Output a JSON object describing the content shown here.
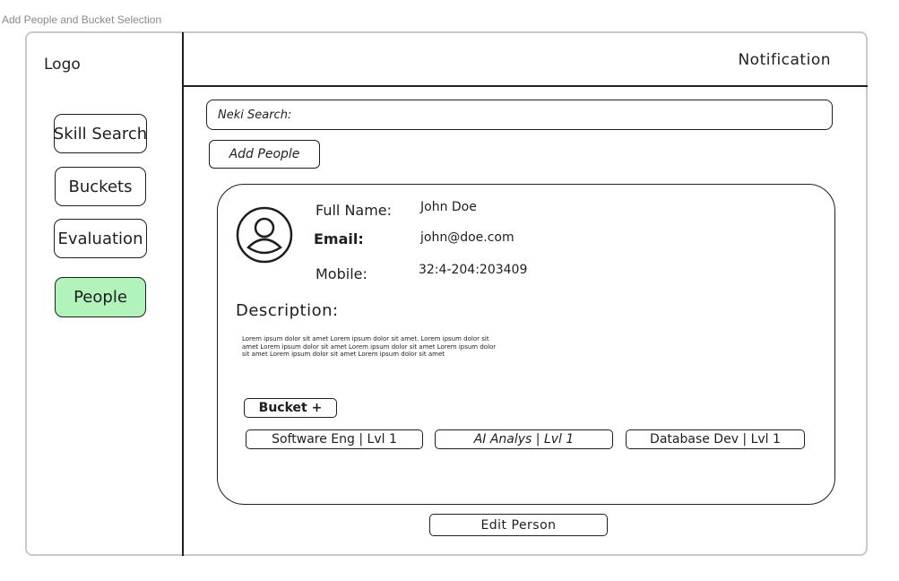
{
  "frame": {
    "title": "Add People and Bucket Selection"
  },
  "header": {
    "logo": "Logo",
    "notification": "Notification"
  },
  "sidebar": {
    "items": [
      {
        "label": "Skill Search"
      },
      {
        "label": "Buckets"
      },
      {
        "label": "Evaluation"
      },
      {
        "label": "People",
        "active": true
      }
    ],
    "active_color": "#b2f2bb"
  },
  "search": {
    "label": "Neki Search:",
    "value": ""
  },
  "add_people_label": "Add People",
  "person": {
    "icon": "user-avatar-icon",
    "full_name_label": "Full Name:",
    "full_name": "John Doe",
    "email_label": "Email:",
    "email": "john@doe.com",
    "mobile_label": "Mobile:",
    "mobile": "32:4-204:203409",
    "description_title": "Description:",
    "description": "Lorem ipsum dolor sit amet Lorem ipsum dolor sit amet. Lorem ipsum dolor sit amet Lorem ipsum dolor sit amet Lorem ipsum dolor sit amet Lorem ipsum dolor sit amet Lorem ipsum dolor sit amet Lorem ipsum dolor sit amet",
    "bucket_button": "Bucket +",
    "buckets": [
      {
        "label": "Software Eng | Lvl 1"
      },
      {
        "label": "AI Analys | Lvl 1"
      },
      {
        "label": "Database Dev | Lvl 1"
      }
    ]
  },
  "edit_person_label": "Edit Person"
}
